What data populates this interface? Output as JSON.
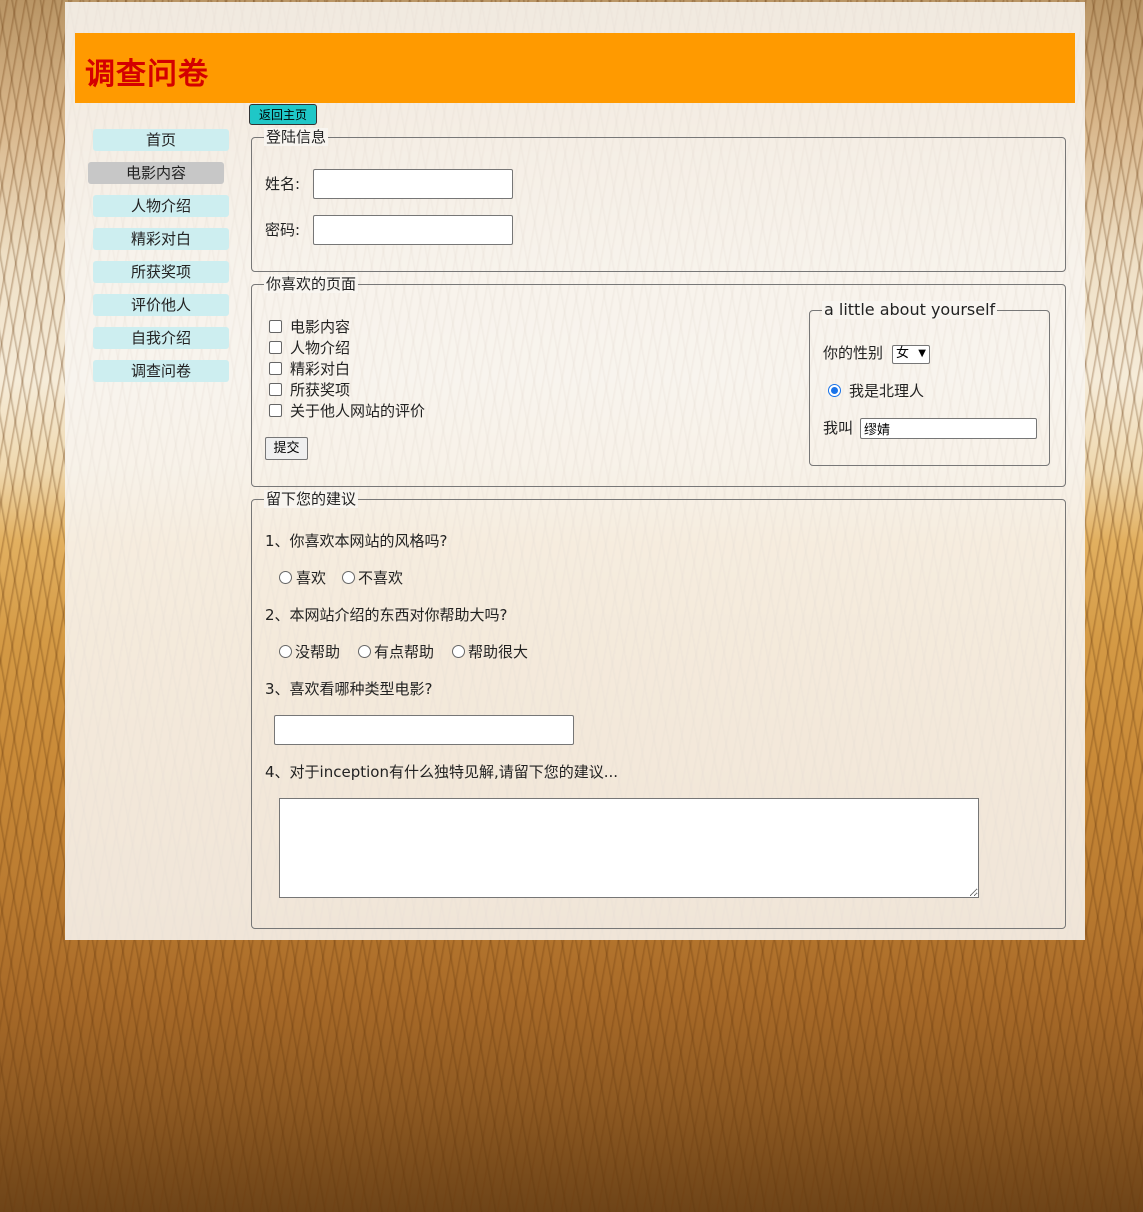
{
  "header": {
    "title": "调查问卷",
    "bg_color": "#ff9a00",
    "title_color": "#d40000"
  },
  "nav": {
    "items": [
      {
        "label": "首页"
      },
      {
        "label": "电影内容",
        "active": true
      },
      {
        "label": "人物介绍"
      },
      {
        "label": "精彩对白"
      },
      {
        "label": "所获奖项"
      },
      {
        "label": "评价他人"
      },
      {
        "label": "自我介绍"
      },
      {
        "label": "调查问卷"
      }
    ]
  },
  "back_button": {
    "label": "返回主页"
  },
  "login": {
    "legend": "登陆信息",
    "name_label": "姓名:",
    "name_value": "",
    "password_label": "密码:",
    "password_value": ""
  },
  "favorites": {
    "legend": "你喜欢的页面",
    "options": [
      "电影内容",
      "人物介绍",
      "精彩对白",
      "所获奖项",
      "关于他人网站的评价"
    ],
    "submit_label": "提交"
  },
  "about": {
    "legend": "a little about yourself",
    "gender_label": "你的性别",
    "gender_value": "女",
    "radio_label": "我是北理人",
    "name_label": "我叫",
    "name_value": "缪婧"
  },
  "suggest": {
    "legend": "留下您的建议",
    "q1": "1、你喜欢本网站的风格吗?",
    "q1_options": [
      "喜欢",
      "不喜欢"
    ],
    "q2": "2、本网站介绍的东西对你帮助大吗?",
    "q2_options": [
      "没帮助",
      "有点帮助",
      "帮助很大"
    ],
    "q3": "3、喜欢看哪种类型电影?",
    "q3_value": "",
    "q4": "4、对于inception有什么独特见解,请留下您的建议...",
    "q4_value": ""
  }
}
